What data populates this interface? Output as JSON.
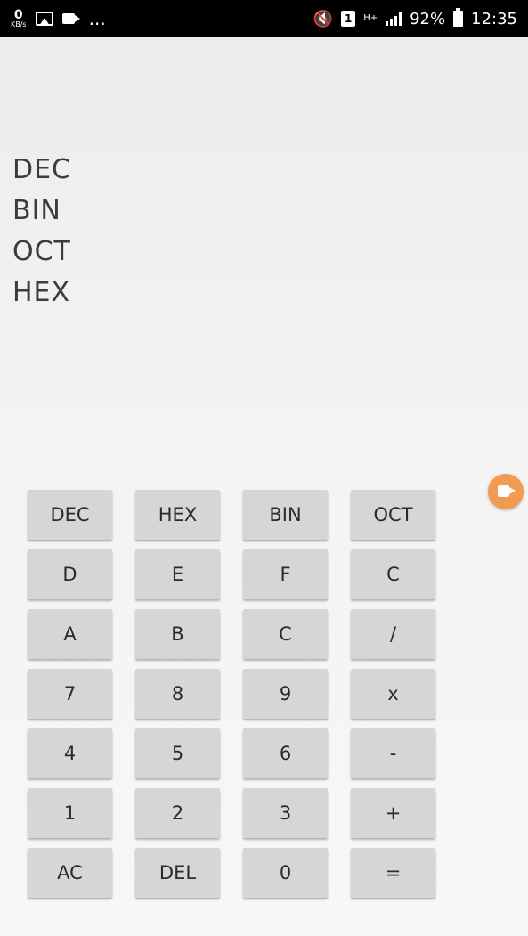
{
  "status_bar": {
    "speed_value": "0",
    "speed_unit": "KB/s",
    "more": "...",
    "network": "H+",
    "battery_percent": "92%",
    "time": "12:35",
    "icons": [
      "image-icon",
      "camera-icon",
      "mute-icon",
      "sim-icon",
      "network-icon",
      "signal-icon",
      "battery-icon"
    ]
  },
  "display": {
    "rows": [
      "DEC",
      "BIN",
      "OCT",
      "HEX"
    ]
  },
  "keypad": {
    "rows": [
      [
        "DEC",
        "HEX",
        "BIN",
        "OCT"
      ],
      [
        "D",
        "E",
        "F",
        "C"
      ],
      [
        "A",
        "B",
        "C",
        "/"
      ],
      [
        "7",
        "8",
        "9",
        "x"
      ],
      [
        "4",
        "5",
        "6",
        "-"
      ],
      [
        "1",
        "2",
        "3",
        "+"
      ],
      [
        "AC",
        "DEL",
        "0",
        "="
      ]
    ]
  },
  "floating_button": {
    "icon": "video-camera-icon",
    "color": "#f29a50"
  },
  "colors": {
    "key_bg": "#d6d6d6",
    "status_bar_bg": "#000000",
    "display_text": "#3c3c3c"
  }
}
